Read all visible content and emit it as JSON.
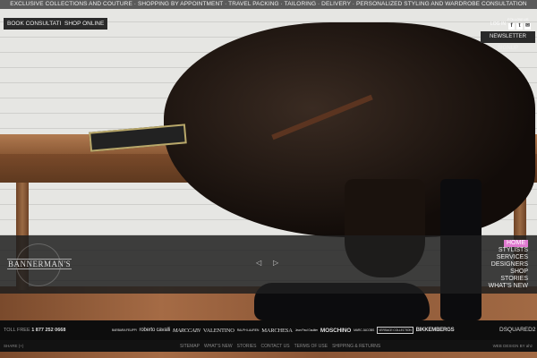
{
  "topbar": {
    "text": "EXCLUSIVE COLLECTIONS AND COUTURE · SHOPPING BY APPOINTMENT · TRAVEL PACKING · TAILORING · DELIVERY · PERSONALIZED STYLING AND WARDROBE CONSULTATION"
  },
  "buttons": {
    "book": "BOOK CONSULTATION",
    "shop": "SHOP ONLINE",
    "newsletter": "NEWSLETTER SIGNUP",
    "login": "LOG IN"
  },
  "social": {
    "label": "FOLLOW US",
    "facebook": "f",
    "twitter": "t",
    "other": "✉"
  },
  "logo": "BANNERMAN'S",
  "slider": {
    "prev": "◁",
    "next": "▷"
  },
  "nav": [
    "HOME",
    "STYLISTS",
    "SERVICES",
    "DESIGNERS",
    "SHOP",
    "STORIES",
    "WHAT'S NEW"
  ],
  "footer": {
    "toll_label": "TOLL FREE",
    "toll_number": "1 877 252 0668",
    "brands": [
      "BARBARA FELIPPI",
      "roberto cavalli",
      "MARCCAIN",
      "VALENTINO",
      "RALPH LAUREN",
      "MARCHESA",
      "Jean Paul Gaultier",
      "MOSCHINO",
      "MARC JACOBS",
      "VERSACE COLLECTION",
      "BIKKEMBERGS",
      "DSQUARED2"
    ],
    "share": "SHARE (+)",
    "links": [
      "SITEMAP",
      "WHAT'S NEW",
      "STORIES",
      "CONTACT US",
      "TERMS OF USE",
      "SHIPPING & RETURNS"
    ],
    "credit": "WEB DESIGN BY ahz"
  }
}
